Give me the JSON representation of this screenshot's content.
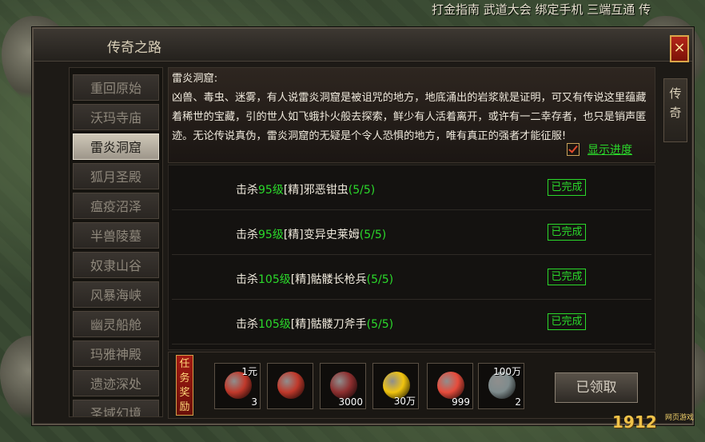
{
  "topbar": {
    "text": "打金指南 武道大会 绑定手机 三端互通 传"
  },
  "window": {
    "title": "传奇之路",
    "close_label": "×",
    "side_tab_label": "传奇"
  },
  "nav": {
    "items": [
      {
        "label": "重回原始",
        "active": false
      },
      {
        "label": "沃玛寺庙",
        "active": false
      },
      {
        "label": "雷炎洞窟",
        "active": true
      },
      {
        "label": "狐月圣殿",
        "active": false
      },
      {
        "label": "瘟疫沼泽",
        "active": false
      },
      {
        "label": "半兽陵墓",
        "active": false
      },
      {
        "label": "奴隶山谷",
        "active": false
      },
      {
        "label": "风暴海峡",
        "active": false
      },
      {
        "label": "幽灵船舱",
        "active": false
      },
      {
        "label": "玛雅神殿",
        "active": false
      },
      {
        "label": "遗迹深处",
        "active": false
      },
      {
        "label": "圣域幻境",
        "active": false
      }
    ]
  },
  "description": {
    "heading": "雷炎洞窟:",
    "body": "凶兽、毒虫、迷雾，有人说雷炎洞窟是被诅咒的地方，地底涌出的岩浆就是证明，可又有传说这里蕴藏着稀世的宝藏，引的世人如飞蛾扑火般去探索，鲜少有人活着离开，或许有一二幸存者，也只是销声匿迹。无论传说真伪，雷炎洞窟的无疑是个令人恐惧的地方，唯有真正的强者才能征服!",
    "show_progress_label": "显示进度",
    "show_progress_checked": true
  },
  "tasks": [
    {
      "prefix": "击杀",
      "level": "95级",
      "elite": "[精]",
      "target": "邪恶钳虫",
      "progress": "(5/5)",
      "status": "已完成"
    },
    {
      "prefix": "击杀",
      "level": "95级",
      "elite": "[精]",
      "target": "变异史莱姆",
      "progress": "(5/5)",
      "status": "已完成"
    },
    {
      "prefix": "击杀",
      "level": "105级",
      "elite": "[精]",
      "target": "骷髅长枪兵",
      "progress": "(5/5)",
      "status": "已完成"
    },
    {
      "prefix": "击杀",
      "level": "105级",
      "elite": "[精]",
      "target": "骷髅刀斧手",
      "progress": "(5/5)",
      "status": "已完成"
    }
  ],
  "reward": {
    "badge_label": "任务奖励",
    "items": [
      {
        "icon": "recharge-scroll-icon",
        "top": "1元",
        "count": "3",
        "color": "#c0392b"
      },
      {
        "icon": "ring-icon",
        "top": "",
        "count": "",
        "color": "#c0392b"
      },
      {
        "icon": "emblem-icon",
        "top": "",
        "count": "3000",
        "color": "#8e2f2f"
      },
      {
        "icon": "gold-ingot-icon",
        "top": "",
        "count": "30万",
        "color": "#f1c40f"
      },
      {
        "icon": "red-gem-icon",
        "top": "",
        "count": "999",
        "color": "#e74c3c"
      },
      {
        "icon": "scroll-bundle-icon",
        "top": "100万",
        "count": "2",
        "color": "#7f8c8d"
      }
    ],
    "claim_label": "已领取"
  },
  "brand": {
    "logo": "1912",
    "logo_sub": "网页游戏"
  }
}
